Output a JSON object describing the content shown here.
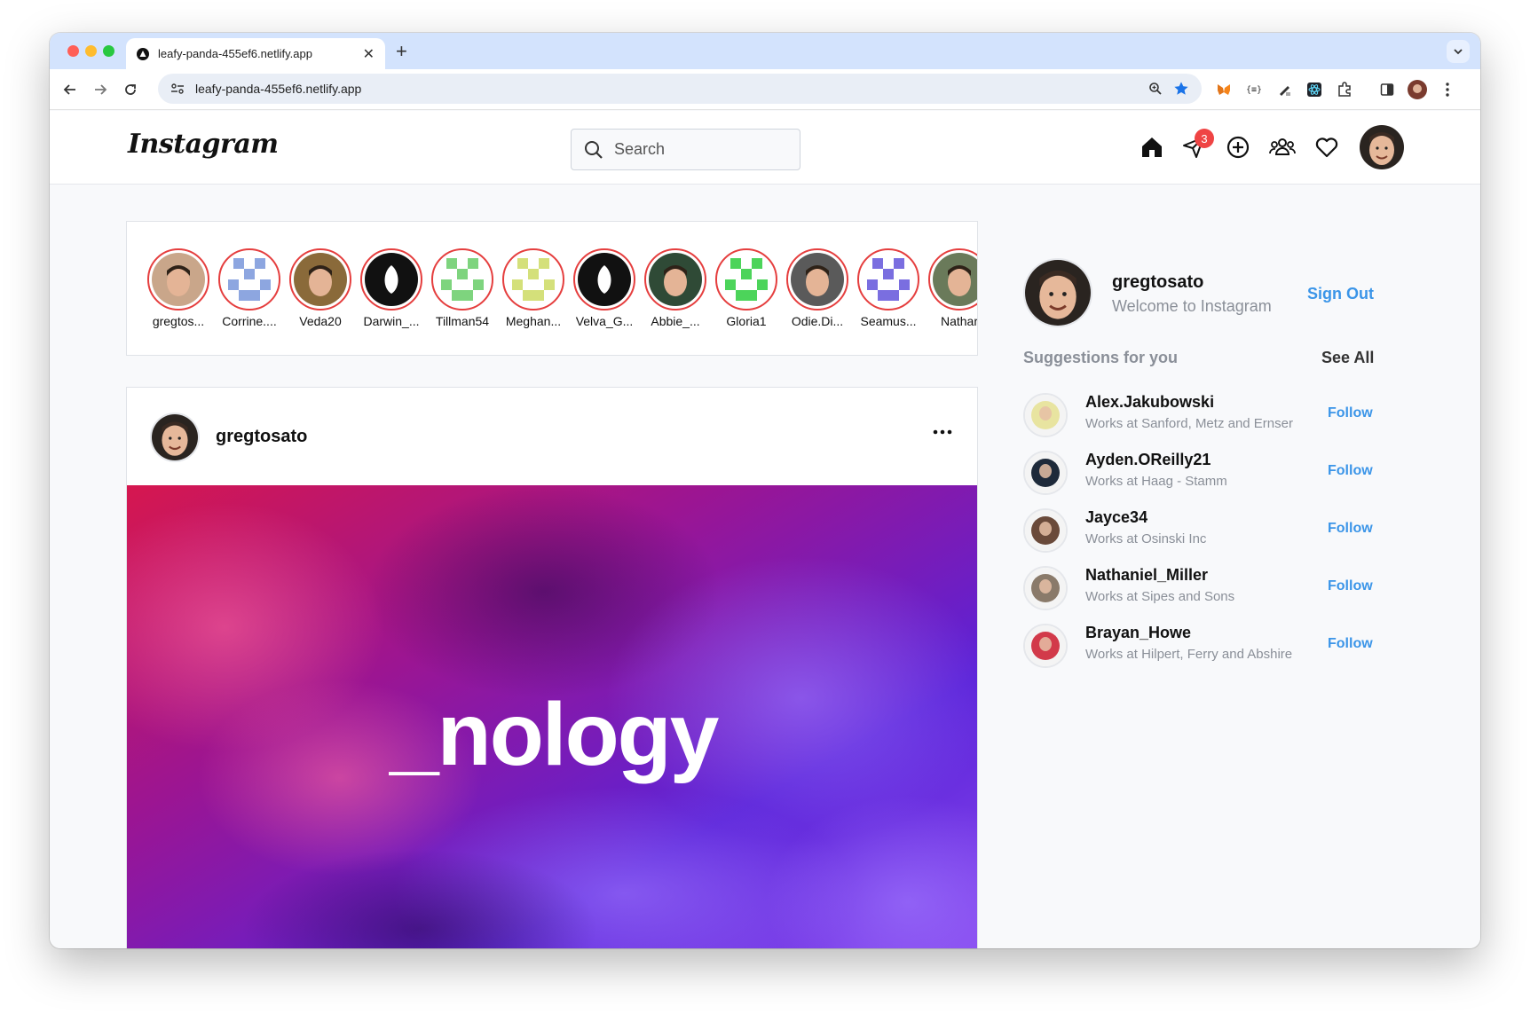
{
  "browser": {
    "tab_title": "leafy-panda-455ef6.netlify.app",
    "url": "leafy-panda-455ef6.netlify.app"
  },
  "header": {
    "logo": "Instagram",
    "search_placeholder": "Search",
    "messages_badge": "3"
  },
  "stories": [
    {
      "name": "gregtos...",
      "type": "photo",
      "color": "#c9a68a"
    },
    {
      "name": "Corrine....",
      "type": "pattern",
      "color": "#8da6e0"
    },
    {
      "name": "Veda20",
      "type": "photo",
      "color": "#8a6a3a"
    },
    {
      "name": "Darwin_...",
      "type": "logo",
      "color": "#111111"
    },
    {
      "name": "Tillman54",
      "type": "pattern",
      "color": "#7ed47e"
    },
    {
      "name": "Meghan...",
      "type": "pattern",
      "color": "#d4e07a"
    },
    {
      "name": "Velva_G...",
      "type": "logo",
      "color": "#111111"
    },
    {
      "name": "Abbie_...",
      "type": "photo",
      "color": "#2f4a36"
    },
    {
      "name": "Gloria1",
      "type": "pattern",
      "color": "#4cd45a"
    },
    {
      "name": "Odie.Di...",
      "type": "photo",
      "color": "#5a5a5a"
    },
    {
      "name": "Seamus...",
      "type": "pattern",
      "color": "#7a6ee0"
    },
    {
      "name": "Nathar",
      "type": "photo",
      "color": "#6a7a5a"
    }
  ],
  "post": {
    "username": "gregtosato",
    "image_text": "_nology"
  },
  "sidebar": {
    "username": "gregtosato",
    "subtitle": "Welcome to Instagram",
    "signout": "Sign Out",
    "suggestions_title": "Suggestions for you",
    "see_all": "See All",
    "follow_label": "Follow",
    "suggestions": [
      {
        "name": "Alex.Jakubowski",
        "sub": "Works at Sanford, Metz and Ernser",
        "color": "#e8e4a0"
      },
      {
        "name": "Ayden.OReilly21",
        "sub": "Works at Haag - Stamm",
        "color": "#1e2a3a"
      },
      {
        "name": "Jayce34",
        "sub": "Works at Osinski Inc",
        "color": "#6a4a3a"
      },
      {
        "name": "Nathaniel_Miller",
        "sub": "Works at Sipes and Sons",
        "color": "#8a7a6a"
      },
      {
        "name": "Brayan_Howe",
        "sub": "Works at Hilpert, Ferry and Abshire",
        "color": "#d23a4a"
      }
    ]
  },
  "colors": {
    "accent": "#3b95e8",
    "story_ring": "#e53e3e",
    "badge": "#ef4444"
  }
}
